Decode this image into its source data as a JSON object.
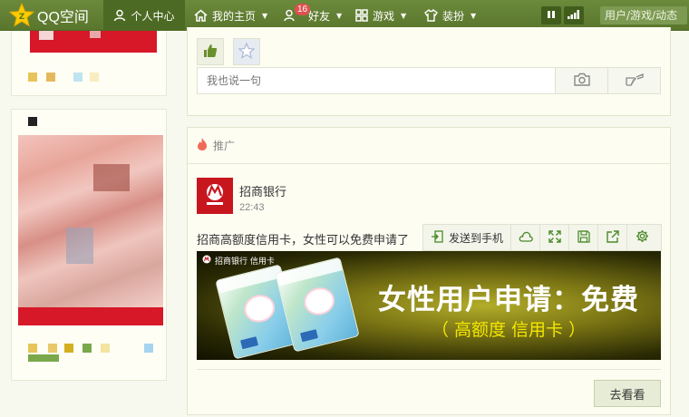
{
  "topnav": {
    "logo_text": "QQ空间",
    "items": [
      {
        "label": "个人中心",
        "active": true
      },
      {
        "label": "我的主页"
      },
      {
        "label": "好友",
        "badge": "16"
      },
      {
        "label": "游戏"
      },
      {
        "label": "装扮"
      }
    ],
    "search_placeholder": "用户/游戏/动态"
  },
  "feed": {
    "comment_placeholder": "我也说一句"
  },
  "ad": {
    "section_label": "推广",
    "advertiser": "招商银行",
    "time": "22:43",
    "text": "招商高额度信用卡，女性可以免费申请了",
    "send_to_phone": "发送到手机",
    "banner_brand": "招商银行 信用卡",
    "banner_title": "女性用户申请：免费",
    "banner_subtitle": "（ 高额度  信用卡 ）",
    "cta_label": "去看看"
  },
  "colors": {
    "nav_green": "#5f7d31",
    "brand_red": "#c8161e",
    "banner_yellow": "#f4e600"
  }
}
